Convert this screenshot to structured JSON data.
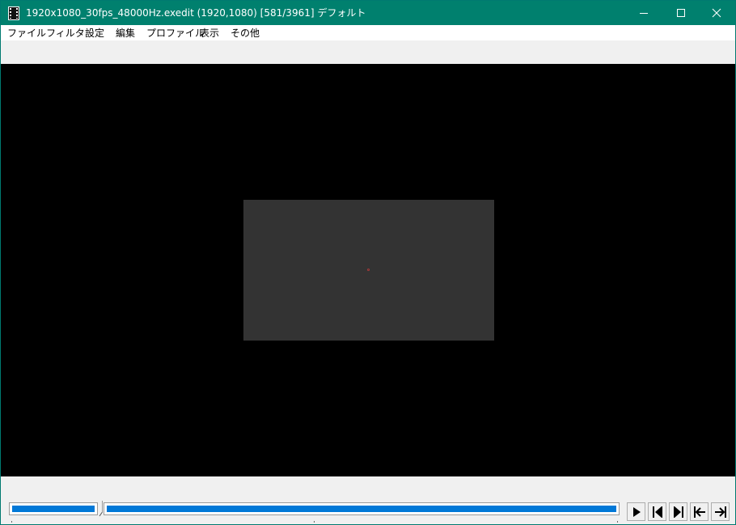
{
  "window": {
    "title": "1920x1080_30fps_48000Hz.exedit (1920,1080)  [581/3961]  デフォルト",
    "buttons": {
      "minimize": "minimize-icon",
      "maximize": "maximize-icon",
      "close": "close-icon"
    }
  },
  "menu": {
    "items": [
      {
        "label": "ファイル"
      },
      {
        "label": "フィルタ"
      },
      {
        "label": "設定"
      },
      {
        "label": "編集"
      },
      {
        "label": "プロファイル"
      },
      {
        "label": "表示"
      },
      {
        "label": "その他"
      }
    ]
  },
  "playback": {
    "current_frame": 581,
    "total_frames": 3961,
    "position_fraction": 0.1467
  },
  "controls": {
    "icons": [
      "play-icon",
      "step-back-icon",
      "step-forward-icon",
      "jump-to-start-icon",
      "jump-to-end-icon"
    ]
  },
  "colors": {
    "titlebar": "#00806e",
    "accent": "#0078d7",
    "viewport": "#000000",
    "frame": "#333333"
  }
}
